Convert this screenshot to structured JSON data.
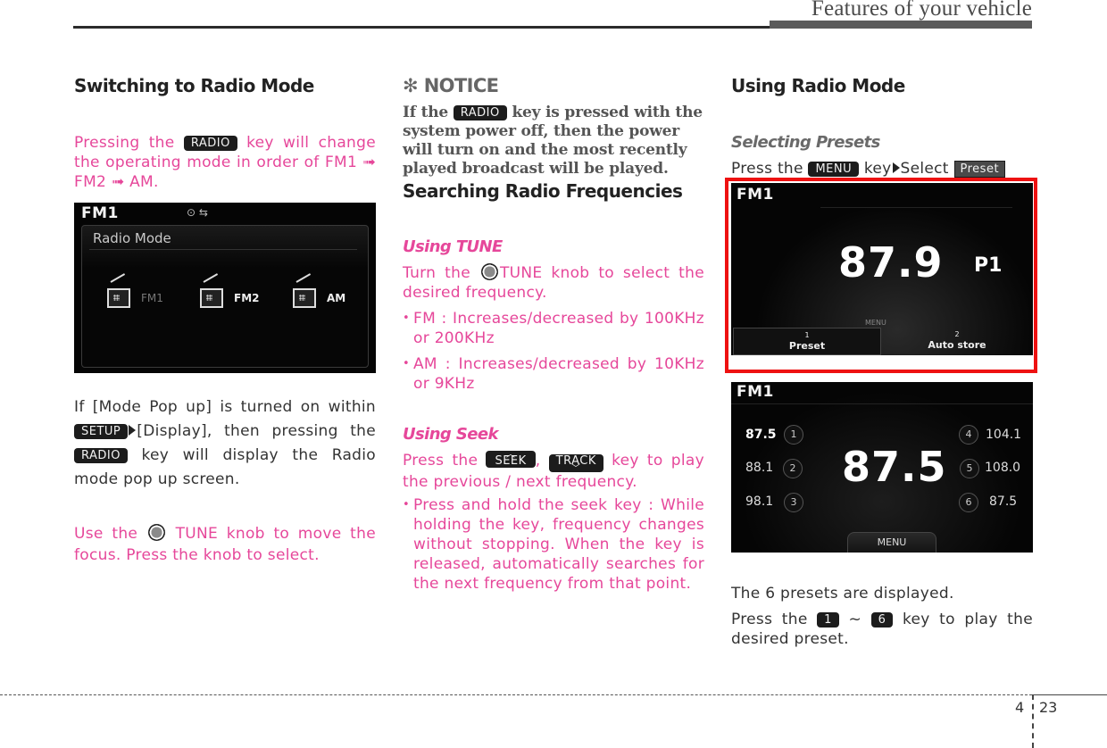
{
  "header": {
    "title": "Features of your vehicle"
  },
  "col1": {
    "heading": "Switching to Radio Mode",
    "p1_before": "Pressing the",
    "p1_key": "RADIO",
    "p1_after": "key will change the operating mode in order of FM1 ➟ FM2 ➟ AM.",
    "screen": {
      "band": "FM1",
      "status_icons": "⊙ ⇆",
      "panel_title": "Radio Mode",
      "modes": [
        {
          "label": "FM1",
          "state": "current"
        },
        {
          "label": "FM2",
          "state": "available"
        },
        {
          "label": "AM",
          "state": "available"
        }
      ]
    },
    "p2_before": "If [Mode Pop up] is turned on within",
    "p2_key1": "SETUP",
    "p2_mid": "[Display], then pressing the",
    "p2_key2": "RADIO",
    "p2_after": "key will display the Radio mode pop up screen.",
    "p3_before": "Use the",
    "p3_after": "TUNE knob to move the focus. Press the knob to select."
  },
  "col2": {
    "notice_title": "✻ NOTICE",
    "notice_before": "If the",
    "notice_key": "RADIO",
    "notice_after": "key is pressed with the system power off, then the power will turn on and the most recently played broadcast will be played.",
    "heading": "Searching Radio Frequencies",
    "tune_title": "Using TUNE",
    "tune_before": "Turn the",
    "tune_after": "TUNE knob to select the desired frequency.",
    "tune_bullets": [
      "FM : Increases/decreased by 100KHz or 200KHz",
      "AM : Increases/decreased by 10KHz or 9KHz"
    ],
    "seek_title": "Using Seek",
    "seek_before": "Press the",
    "seek_key": "SEEK",
    "seek_sep": ",",
    "track_key": "TRACK",
    "seek_after": "key to play the previous / next frequency.",
    "seek_bullet": "Press and hold the seek key : While holding the key, frequency changes without stopping. When the key is released, automatically searches for the next frequency from that point."
  },
  "col3": {
    "heading": "Using Radio Mode",
    "presets_title": "Selecting Presets",
    "presets_before": "Press the",
    "menu_key": "MENU",
    "presets_mid": "key",
    "presets_select": "Select",
    "preset_btn": "Preset",
    "screen_menu": {
      "band": "FM1",
      "frequency": "87.9",
      "preset_indicator": "P1",
      "menu_label": "MENU",
      "options": [
        {
          "num": "1",
          "label": "Preset",
          "selected": true
        },
        {
          "num": "2",
          "label": "Auto store",
          "selected": false
        }
      ]
    },
    "screen_presets": {
      "band": "FM1",
      "frequency": "87.5",
      "menu_tab": "MENU",
      "presets": [
        {
          "num": "1",
          "freq": "87.5",
          "active": true
        },
        {
          "num": "2",
          "freq": "88.1",
          "active": false
        },
        {
          "num": "3",
          "freq": "98.1",
          "active": false
        },
        {
          "num": "4",
          "freq": "104.1",
          "active": false
        },
        {
          "num": "5",
          "freq": "108.0",
          "active": false
        },
        {
          "num": "6",
          "freq": "87.5",
          "active": false
        }
      ]
    },
    "p1": "The 6 presets are displayed.",
    "p2_before": "Press the",
    "key_first": "1",
    "tilde": "~",
    "key_last": "6",
    "p2_after": "key to play the desired preset."
  },
  "footer": {
    "section": "4",
    "page": "23"
  }
}
